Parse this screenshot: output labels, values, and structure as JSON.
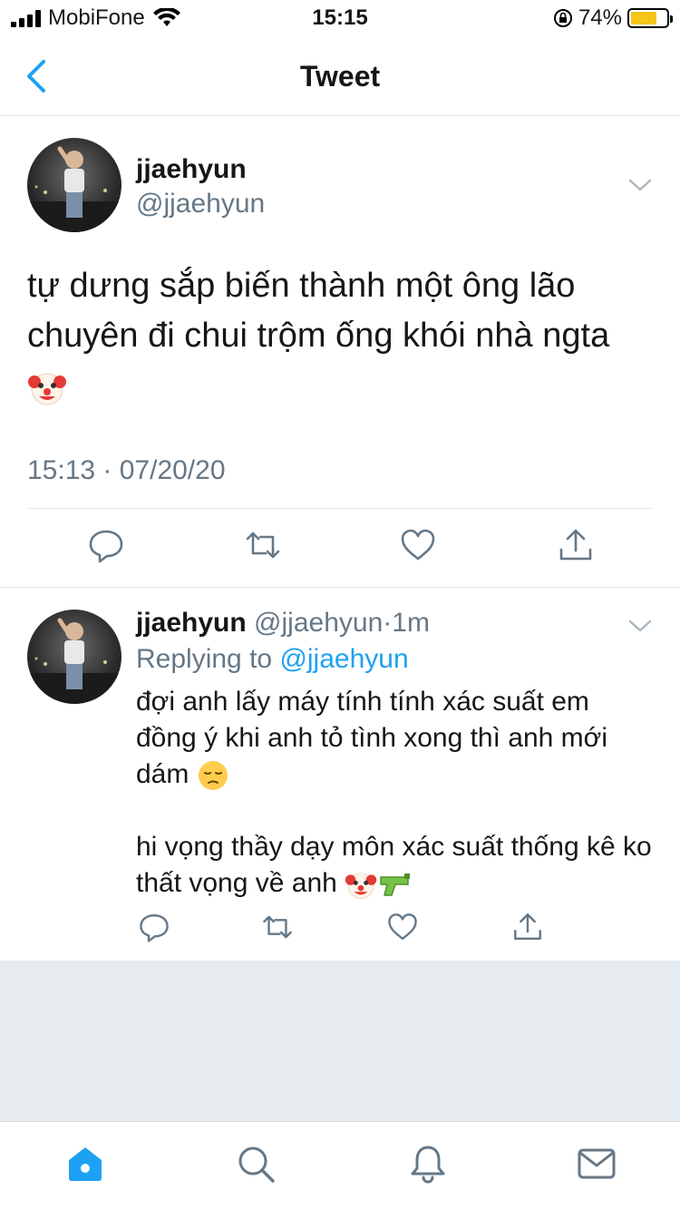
{
  "status_bar": {
    "carrier": "MobiFone",
    "time": "15:15",
    "battery": "74%",
    "battery_level": 0.74
  },
  "header": {
    "title": "Tweet",
    "back_icon": "chevron-left-icon"
  },
  "main_tweet": {
    "author_name": "jjaehyun",
    "author_handle": "@jjaehyun",
    "text": "tự dưng sắp biến thành một ông lão chuyên đi chui trộm ống khói nhà ngta",
    "emoji": "clown-face",
    "timestamp": "15:13 · 07/20/20"
  },
  "reply_tweet": {
    "author_name": "jjaehyun",
    "author_handle": "@jjaehyun",
    "separator": "·",
    "age": "1m",
    "replying_label": "Replying to",
    "replying_to": "@jjaehyun",
    "paragraph1": "đợi anh lấy máy tính tính xác suất em đồng ý khi anh tỏ tình xong thì anh mới dám",
    "paragraph2": "hi vọng thầy dạy môn xác suất thống kê ko thất vọng về anh"
  },
  "actions": [
    "reply-icon",
    "retweet-icon",
    "like-icon",
    "share-icon"
  ],
  "tabs": [
    "home-icon",
    "search-icon",
    "notifications-icon",
    "messages-icon"
  ],
  "colors": {
    "accent": "#1da1f2",
    "secondary_text": "#657786",
    "divider": "#e1e8ed",
    "background_fill": "#e6ecf0"
  }
}
